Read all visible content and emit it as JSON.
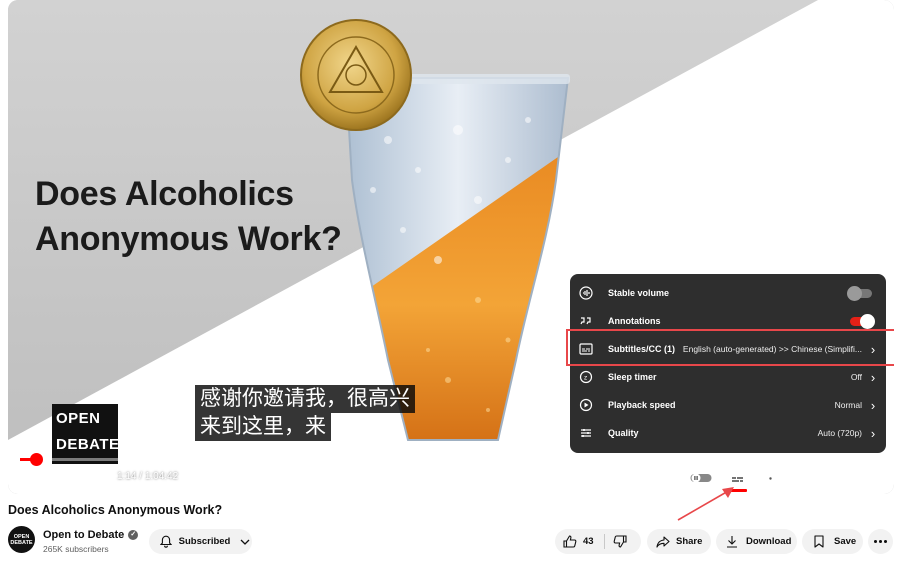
{
  "video": {
    "title_overlay": "Does Alcoholics Anonymous Work?",
    "logo_lines": [
      "OPEN",
      "DEBATE"
    ],
    "subtitle_lines": [
      "感谢你邀请我，很高兴",
      "来到这里，来"
    ],
    "time": {
      "current": "1:14",
      "separator": " / ",
      "duration": "1:04:42"
    },
    "progress_fraction": 0.019
  },
  "settings_menu": {
    "items": [
      {
        "label": "Stable volume",
        "icon": "stable-volume-icon",
        "toggle": "off"
      },
      {
        "label": "Annotations",
        "icon": "annotations-icon",
        "toggle": "on"
      },
      {
        "label": "Subtitles/CC (1)",
        "icon": "subtitles-icon",
        "value": "English (auto-generated) >> Chinese (Simplifi..."
      },
      {
        "label": "Sleep timer",
        "icon": "sleep-timer-icon",
        "value": "Off"
      },
      {
        "label": "Playback speed",
        "icon": "playback-speed-icon",
        "value": "Normal"
      },
      {
        "label": "Quality",
        "icon": "quality-icon",
        "value": "Auto (720p)"
      }
    ]
  },
  "below": {
    "title": "Does Alcoholics Anonymous Work?",
    "channel": {
      "name": "Open to Debate",
      "subscribers": "265K subscribers",
      "avatar_lines": [
        "OPEN",
        "DEBATE"
      ]
    },
    "subscribed_label": "Subscribed",
    "likes": "43",
    "share_label": "Share",
    "download_label": "Download",
    "save_label": "Save"
  },
  "colors": {
    "accent_red": "#e62117",
    "annotation_red": "#e8474a"
  }
}
